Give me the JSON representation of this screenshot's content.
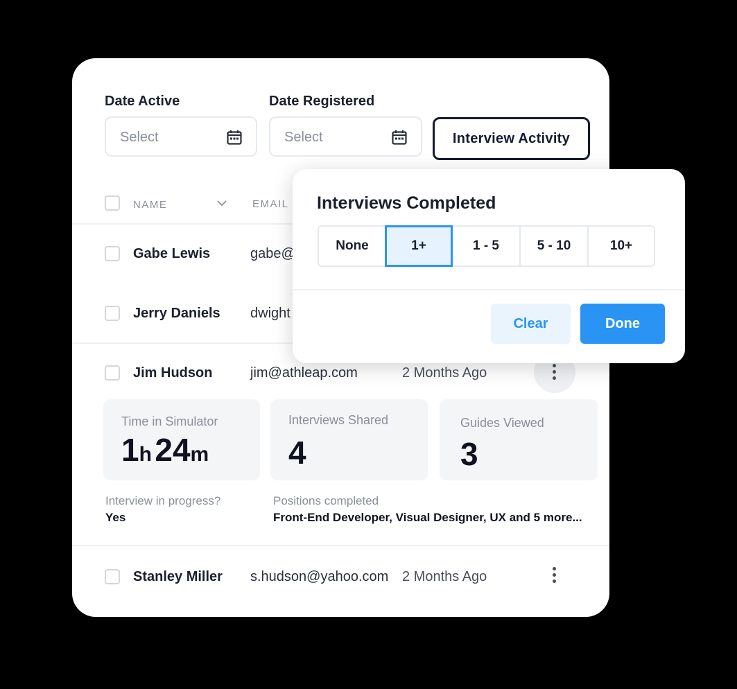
{
  "filters": {
    "date_active": {
      "label": "Date Active",
      "placeholder": "Select",
      "icon": "calendar-icon"
    },
    "date_registered": {
      "label": "Date Registered",
      "placeholder": "Select",
      "icon": "calendar-icon"
    },
    "interview_activity": "Interview Activity"
  },
  "table": {
    "columns": {
      "name": "NAME",
      "email": "EMAIL"
    },
    "rows": [
      {
        "name": "Gabe Lewis",
        "email": "gabe@",
        "when": ""
      },
      {
        "name": "Jerry Daniels",
        "email": "dwight",
        "when": ""
      },
      {
        "name": "Jim Hudson",
        "email": "jim@athleap.com",
        "when": "2 Months Ago"
      },
      {
        "name": "Stanley Miller",
        "email": "s.hudson@yahoo.com",
        "when": "2 Months Ago"
      }
    ]
  },
  "details": {
    "time_in_simulator": {
      "label": "Time in Simulator",
      "hours": "1",
      "h_unit": "h",
      "minutes": "24",
      "m_unit": "m"
    },
    "interviews_shared": {
      "label": "Interviews Shared",
      "value": "4"
    },
    "guides_viewed": {
      "label": "Guides Viewed",
      "value": "3"
    },
    "interview_in_progress": {
      "label": "Interview in progress?",
      "value": "Yes"
    },
    "positions_completed": {
      "label": "Positions completed",
      "value": "Front-End Developer, Visual Designer, UX and 5 more..."
    }
  },
  "popup": {
    "title": "Interviews Completed",
    "options": [
      "None",
      "1+",
      "1 - 5",
      "5 - 10",
      "10+"
    ],
    "selected": "1+",
    "clear_label": "Clear",
    "done_label": "Done"
  },
  "colors": {
    "accent": "#2a94f4",
    "dark": "#151a30",
    "background": "#000000"
  }
}
